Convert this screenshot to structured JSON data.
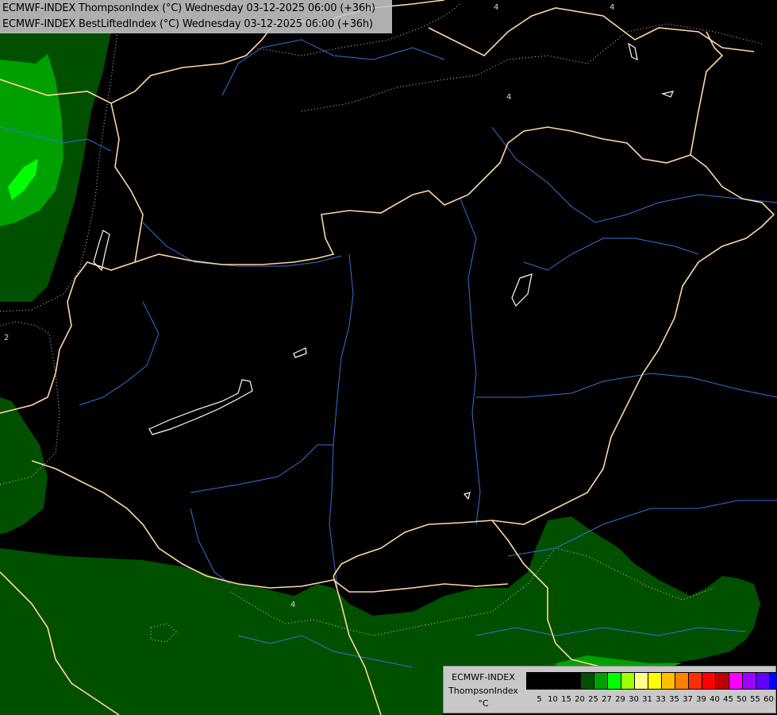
{
  "map": {
    "title_line1": "ECMWF-INDEX ThompsonIndex (°C) Wednesday 03-12-2025 06:00 (+36h)",
    "title_line2": "ECMWF-INDEX BestLiftedIndex (°C) Wednesday 03-12-2025 06:00 (+36h)"
  },
  "contour_labels": [
    "4",
    "4",
    "4",
    "2",
    "4"
  ],
  "legend": {
    "source": "ECMWF-INDEX",
    "parameter": "ThompsonIndex",
    "unit": "°C",
    "ticks": [
      "5",
      "10",
      "15",
      "20",
      "25",
      "27",
      "29",
      "30",
      "31",
      "33",
      "35",
      "37",
      "39",
      "40",
      "45",
      "50",
      "55",
      "60"
    ],
    "colors": [
      "#000000",
      "#000000",
      "#000000",
      "#000000",
      "#005000",
      "#00a000",
      "#00ff00",
      "#a0ff00",
      "#ffff90",
      "#ffff00",
      "#ffc000",
      "#ff8000",
      "#ff3000",
      "#ff0000",
      "#c00000",
      "#ff00ff",
      "#a000ff",
      "#6000ff",
      "#0000ff"
    ]
  },
  "colors": {
    "background": "#000000",
    "low_band": "#005000",
    "mid_band": "#00a000",
    "high_band": "#00ff00",
    "borders": "#ffd7a6",
    "rivers": "#3b6fd6",
    "lakes": "#ffffff"
  }
}
